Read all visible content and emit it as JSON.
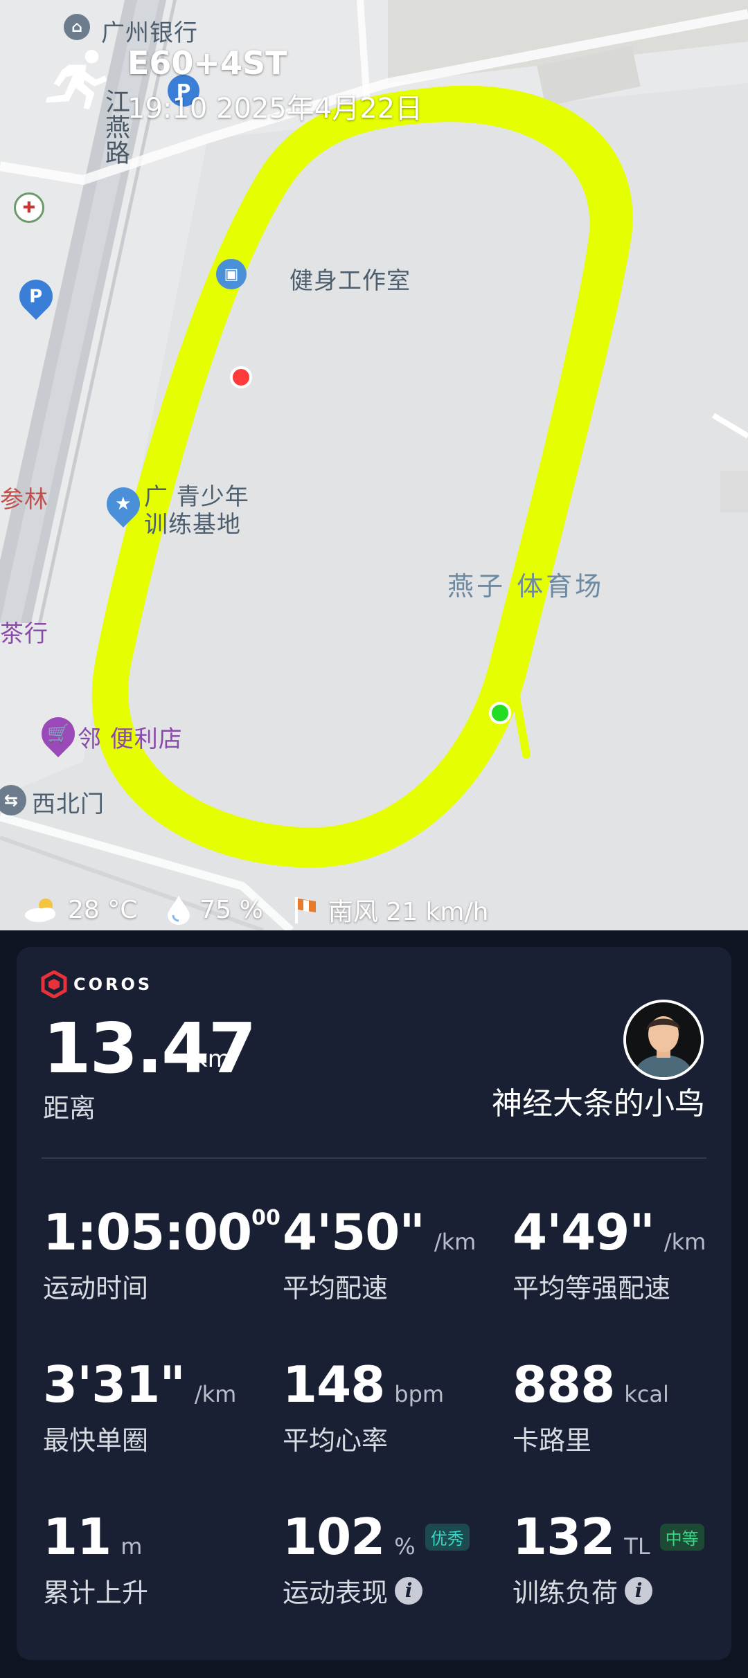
{
  "header": {
    "workout_name": "E60+4ST",
    "datetime": "19:10 2025年4月22日"
  },
  "map": {
    "labels": {
      "bank": "广州银行",
      "road": "江燕路",
      "gym": "健身工作室",
      "youth_base_line1": "广   青少年",
      "youth_base_line2": "训练基地",
      "stadium": "燕子   体育场",
      "store": "邻   便利店",
      "north_gate": "西北门",
      "left_edge_1": "参林",
      "left_edge_2": "茶行"
    },
    "route_color": "#e6ff00"
  },
  "weather": {
    "temperature": "28 °C",
    "humidity": "75  %",
    "wind": "南风 21 km/h"
  },
  "card": {
    "brand": "COROS",
    "distance": {
      "value": "13.47",
      "unit": "km",
      "label": "距离"
    },
    "username": "神经大条的小鸟",
    "stats": [
      {
        "value": "1:05:00",
        "sup": "00",
        "unit": "",
        "label": "运动时间"
      },
      {
        "value": "4'50\"",
        "unit": "/km",
        "label": "平均配速"
      },
      {
        "value": "4'49\"",
        "unit": "/km",
        "label": "平均等强配速"
      },
      {
        "value": "3'31\"",
        "unit": "/km",
        "label": "最快单圈"
      },
      {
        "value": "148",
        "unit": "bpm",
        "label": "平均心率"
      },
      {
        "value": "888",
        "unit": "kcal",
        "label": "卡路里"
      },
      {
        "value": "11",
        "unit": "m",
        "label": "累计上升"
      },
      {
        "value": "102",
        "unit": "%",
        "badge": "优秀",
        "label": "运动表现"
      },
      {
        "value": "132",
        "unit": "TL",
        "badge": "中等",
        "label": "训练负荷"
      }
    ]
  }
}
